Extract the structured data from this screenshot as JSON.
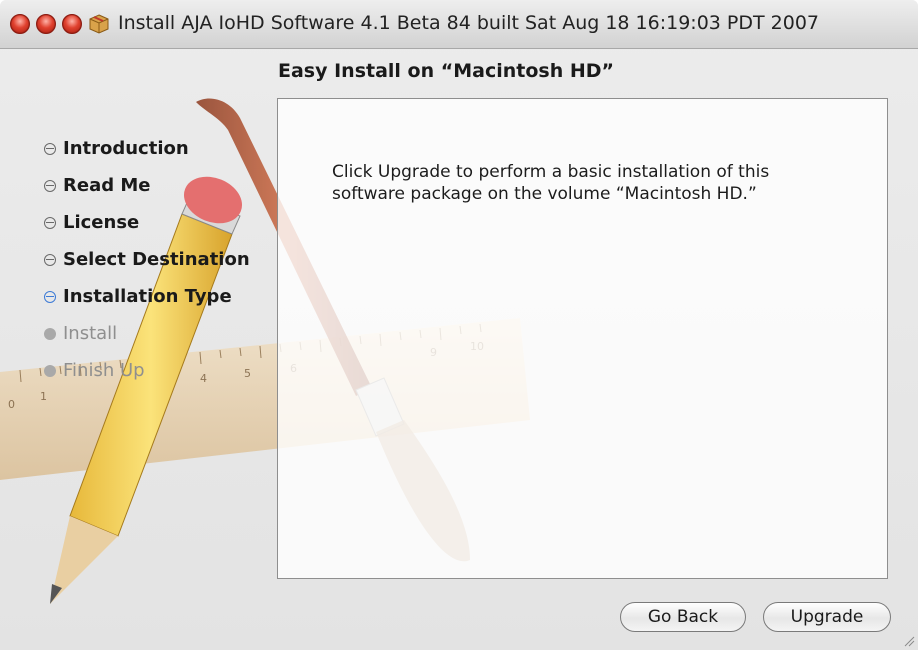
{
  "window": {
    "title": "Install AJA IoHD Software 4.1 Beta 84 built Sat Aug 18 16:19:03 PDT 2007"
  },
  "heading": "Easy Install on “Macintosh HD”",
  "sidebar": {
    "steps": [
      {
        "label": "Introduction",
        "state": "done"
      },
      {
        "label": "Read Me",
        "state": "done"
      },
      {
        "label": "License",
        "state": "done"
      },
      {
        "label": "Select Destination",
        "state": "done"
      },
      {
        "label": "Installation Type",
        "state": "current"
      },
      {
        "label": "Install",
        "state": "future"
      },
      {
        "label": "Finish Up",
        "state": "future"
      }
    ]
  },
  "content": {
    "message": "Click Upgrade to perform a basic installation of this software package on the volume “Macintosh HD.”"
  },
  "buttons": {
    "back_label": "Go Back",
    "upgrade_label": "Upgrade"
  },
  "ruler": {
    "numbers": [
      "0",
      "1",
      "4",
      "5",
      "6",
      "9",
      "10"
    ]
  },
  "colors": {
    "current_step": "#3d7bd6",
    "close_button": "#e0412f"
  }
}
